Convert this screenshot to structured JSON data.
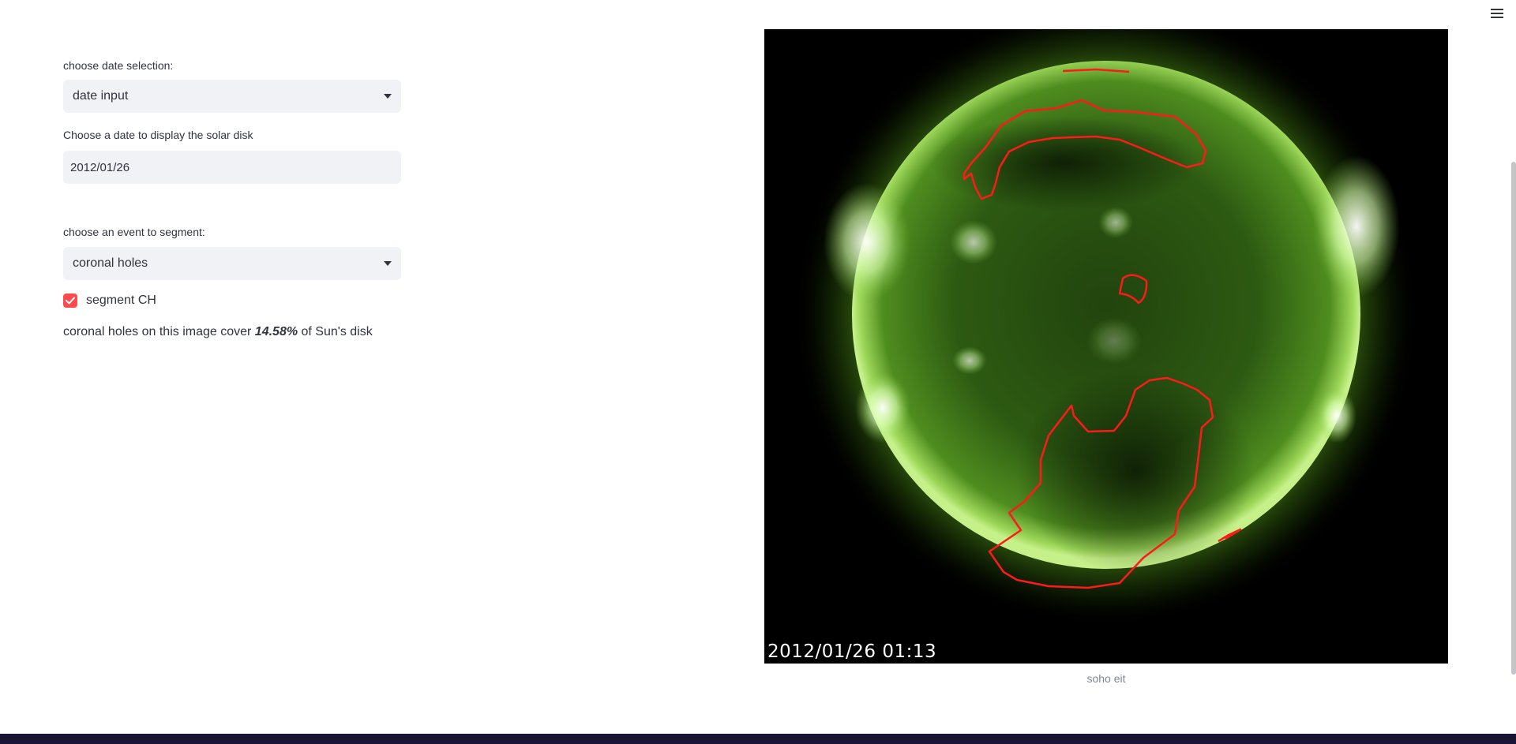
{
  "menu": {
    "icon": "hamburger-menu-icon"
  },
  "form": {
    "date_selection_label": "choose date selection:",
    "date_selection_value": "date input",
    "date_label": "Choose a date to display the solar disk",
    "date_value": "2012/01/26",
    "event_label": "choose an event to segment:",
    "event_value": "coronal holes",
    "segment_label": "segment CH",
    "segment_checked": true
  },
  "result": {
    "prefix": "coronal holes on this image cover ",
    "percent": "14.58%",
    "suffix": " of Sun's disk"
  },
  "image": {
    "timestamp": "2012/01/26 01:13",
    "caption": "soho eit",
    "contour_color": "#ff1a1a"
  },
  "colors": {
    "accent": "#ff4b4b",
    "input_bg": "#f0f2f6",
    "text": "#31333f"
  }
}
